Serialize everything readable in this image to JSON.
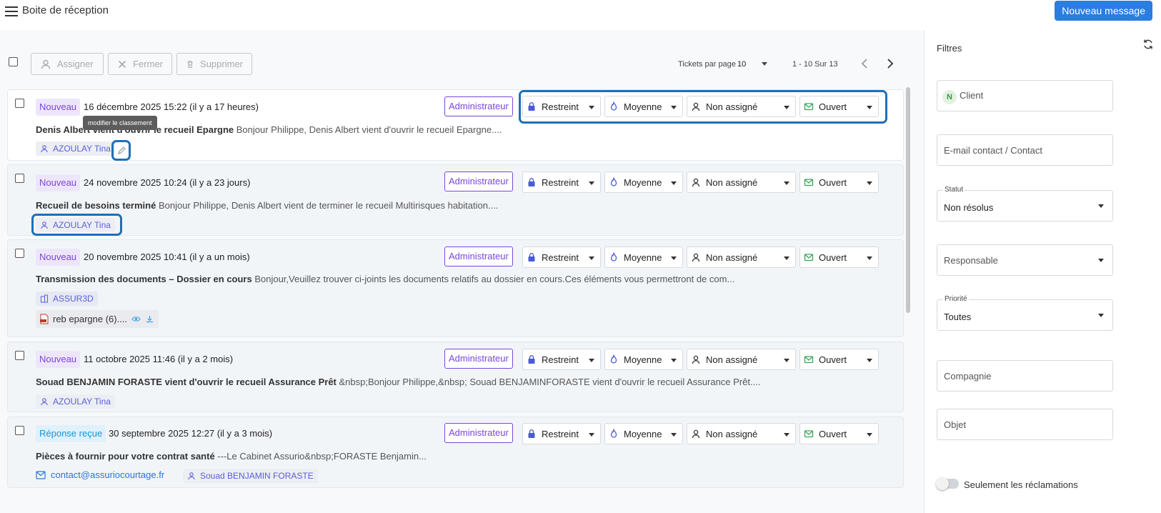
{
  "header": {
    "title": "Boite de réception",
    "new_message": "Nouveau message"
  },
  "toolbar": {
    "assign": "Assigner",
    "close": "Fermer",
    "delete": "Supprimer",
    "tickets_per_page_label": "Tickets par page",
    "tickets_per_page_value": "10",
    "pagination": "1 - 10 Sur 13"
  },
  "tooltip": "modifier le classement",
  "tickets": [
    {
      "status": "Nouveau",
      "date": "16 décembre 2025 15:22 (il y a 17 heures)",
      "role": "Administrateur",
      "visibility": "Restreint",
      "priority": "Moyenne",
      "assignee": "Non assigné",
      "state": "Ouvert",
      "subject_bold": "Denis Albert vient d'ouvrir le recueil Epargne",
      "subject_rest": " Bonjour Philippe, Denis Albert vient d'ouvrir le recueil Epargne....",
      "chip": "AZOULAY Tina"
    },
    {
      "status": "Nouveau",
      "date": "24 novembre 2025 10:24 (il y a 23 jours)",
      "role": "Administrateur",
      "visibility": "Restreint",
      "priority": "Moyenne",
      "assignee": "Non assigné",
      "state": "Ouvert",
      "subject_bold": "Recueil de besoins terminé",
      "subject_rest": " Bonjour Philippe, Denis Albert vient de terminer le recueil Multirisques habitation....",
      "chip": "AZOULAY Tina"
    },
    {
      "status": "Nouveau",
      "date": "20 novembre 2025 10:41 (il y a un mois)",
      "role": "Administrateur",
      "visibility": "Restreint",
      "priority": "Moyenne",
      "assignee": "Non assigné",
      "state": "Ouvert",
      "subject_bold": "Transmission des documents – Dossier en cours",
      "subject_rest": " Bonjour,Veuillez trouver ci-joints les documents relatifs au dossier en cours.Ces éléments vous permettront de com...",
      "chip": "ASSUR3D",
      "attachment": "reb epargne (6)...."
    },
    {
      "status": "Nouveau",
      "date": "11 octobre 2025 11:46 (il y a 2 mois)",
      "role": "Administrateur",
      "visibility": "Restreint",
      "priority": "Moyenne",
      "assignee": "Non assigné",
      "state": "Ouvert",
      "subject_bold": "Souad BENJAMIN FORASTE vient d'ouvrir le recueil Assurance Prêt",
      "subject_rest": " &nbsp;Bonjour Philippe,&nbsp; Souad BENJAMINFORASTE vient d'ouvrir le recueil Assurance Prêt....",
      "chip": "AZOULAY Tina"
    },
    {
      "status": "Réponse reçue",
      "date": "30 septembre 2025 12:27 (il y a 3 mois)",
      "role": "Administrateur",
      "visibility": "Restreint",
      "priority": "Moyenne",
      "assignee": "Non assigné",
      "state": "Ouvert",
      "subject_bold": "Pièces à fournir pour votre contrat santé",
      "subject_rest": " ---Le Cabinet Assurio&nbsp;FORASTE Benjamin...",
      "email": "contact@assuriocourtage.fr",
      "chip": "Souad BENJAMIN FORASTE"
    }
  ],
  "filters": {
    "title": "Filtres",
    "client_placeholder": "Client",
    "client_avatar": "N",
    "email_placeholder": "E-mail contact / Contact",
    "statut_label": "Statut",
    "statut_value": "Non résolus",
    "responsable_placeholder": "Responsable",
    "priorite_label": "Priorité",
    "priorite_value": "Toutes",
    "compagnie_placeholder": "Compagnie",
    "objet_placeholder": "Objet",
    "reclamations_toggle": "Seulement les réclamations"
  },
  "colors": {
    "accent": "#2a7de1",
    "status_new": "#7b46d8",
    "status_reply": "#1a94d8",
    "chip_text": "#5b5fd8",
    "highlight": "#1e6fb8"
  }
}
